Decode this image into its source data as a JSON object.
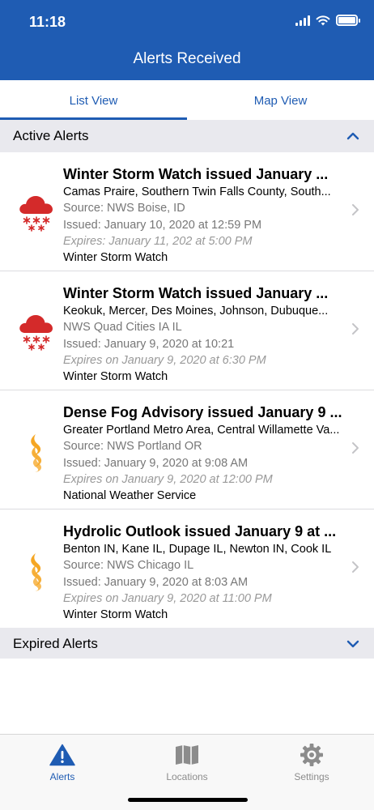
{
  "status_bar": {
    "time": "11:18"
  },
  "header": {
    "title": "Alerts Received"
  },
  "tabs": [
    {
      "label": "List View",
      "active": true
    },
    {
      "label": "Map View",
      "active": false
    }
  ],
  "active_section": {
    "label": "Active Alerts"
  },
  "alerts": [
    {
      "icon": "snow-cloud-icon",
      "title": "Winter Storm Watch issued January ...",
      "areas": "Camas Praire, Southern Twin Falls County, South...",
      "source": "Source: NWS Boise, ID",
      "issued": "Issued: January 10, 2020 at 12:59 PM",
      "expires": "Expires: January 11, 202 at 5:00 PM",
      "event": "Winter Storm Watch"
    },
    {
      "icon": "snow-cloud-icon",
      "title": "Winter Storm Watch issued January ...",
      "areas": "Keokuk, Mercer, Des Moines, Johnson, Dubuque...",
      "source": "NWS Quad Cities IA IL",
      "issued": "Issued: January 9, 2020 at 10:21",
      "expires": "Expires on January 9, 2020 at 6:30 PM",
      "event": "Winter Storm Watch"
    },
    {
      "icon": "fog-icon",
      "title": "Dense Fog Advisory issued January 9 ...",
      "areas": "Greater Portland Metro Area, Central Willamette Va...",
      "source": "Source: NWS Portland OR",
      "issued": "Issued: January 9, 2020 at 9:08 AM",
      "expires": "Expires on January 9, 2020 at 12:00 PM",
      "event": "National Weather Service"
    },
    {
      "icon": "fog-icon",
      "title": "Hydrolic Outlook issued January 9 at ...",
      "areas": "Benton IN, Kane IL, Dupage IL, Newton IN, Cook IL",
      "source": "Source: NWS Chicago IL",
      "issued": "Issued: January 9, 2020 at 8:03 AM",
      "expires": "Expires on January 9, 2020 at 11:00 PM",
      "event": "Winter Storm Watch"
    }
  ],
  "expired_section": {
    "label": "Expired Alerts"
  },
  "tabbar": [
    {
      "label": "Alerts",
      "icon": "warning-triangle-icon",
      "active": true
    },
    {
      "label": "Locations",
      "icon": "map-icon",
      "active": false
    },
    {
      "label": "Settings",
      "icon": "gear-icon",
      "active": false
    }
  ],
  "colors": {
    "brand": "#1f5cb3",
    "section_bg": "#e9e9ee",
    "snow_icon": "#d42a2a",
    "fog_icon": "#f5a623"
  }
}
